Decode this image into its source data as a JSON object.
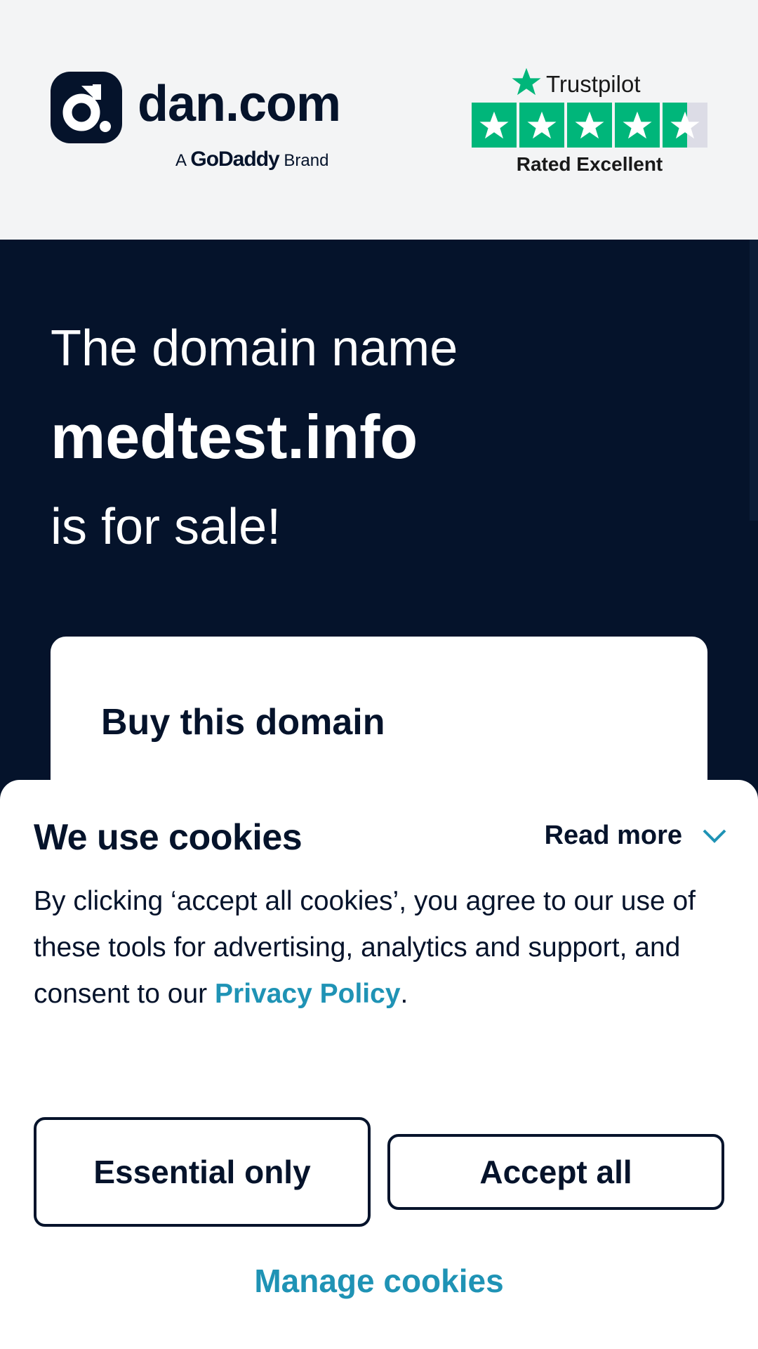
{
  "header": {
    "logo_text": "dan.com",
    "brand_prefix": "A",
    "brand_name": "GoDaddy",
    "brand_suffix": "Brand",
    "trustpilot": {
      "name": "Trustpilot",
      "rating_label": "Rated Excellent",
      "stars": 4.5
    }
  },
  "hero": {
    "line1": "The domain name",
    "domain": "medtest.info",
    "line3": "is for sale!"
  },
  "buy_card": {
    "title": "Buy this domain"
  },
  "cookie_banner": {
    "title": "We use cookies",
    "read_more": "Read more",
    "text_before": "By clicking ‘accept all cookies’, you agree to our use of these tools for advertising, analytics and support, and consent to our ",
    "privacy_link": "Privacy Policy",
    "text_after": ".",
    "essential_button": "Essential only",
    "accept_button": "Accept all",
    "manage_link": "Manage cookies"
  },
  "colors": {
    "navy": "#05132b",
    "trustpilot_green": "#00b67a",
    "link_teal": "#1f93b5"
  }
}
